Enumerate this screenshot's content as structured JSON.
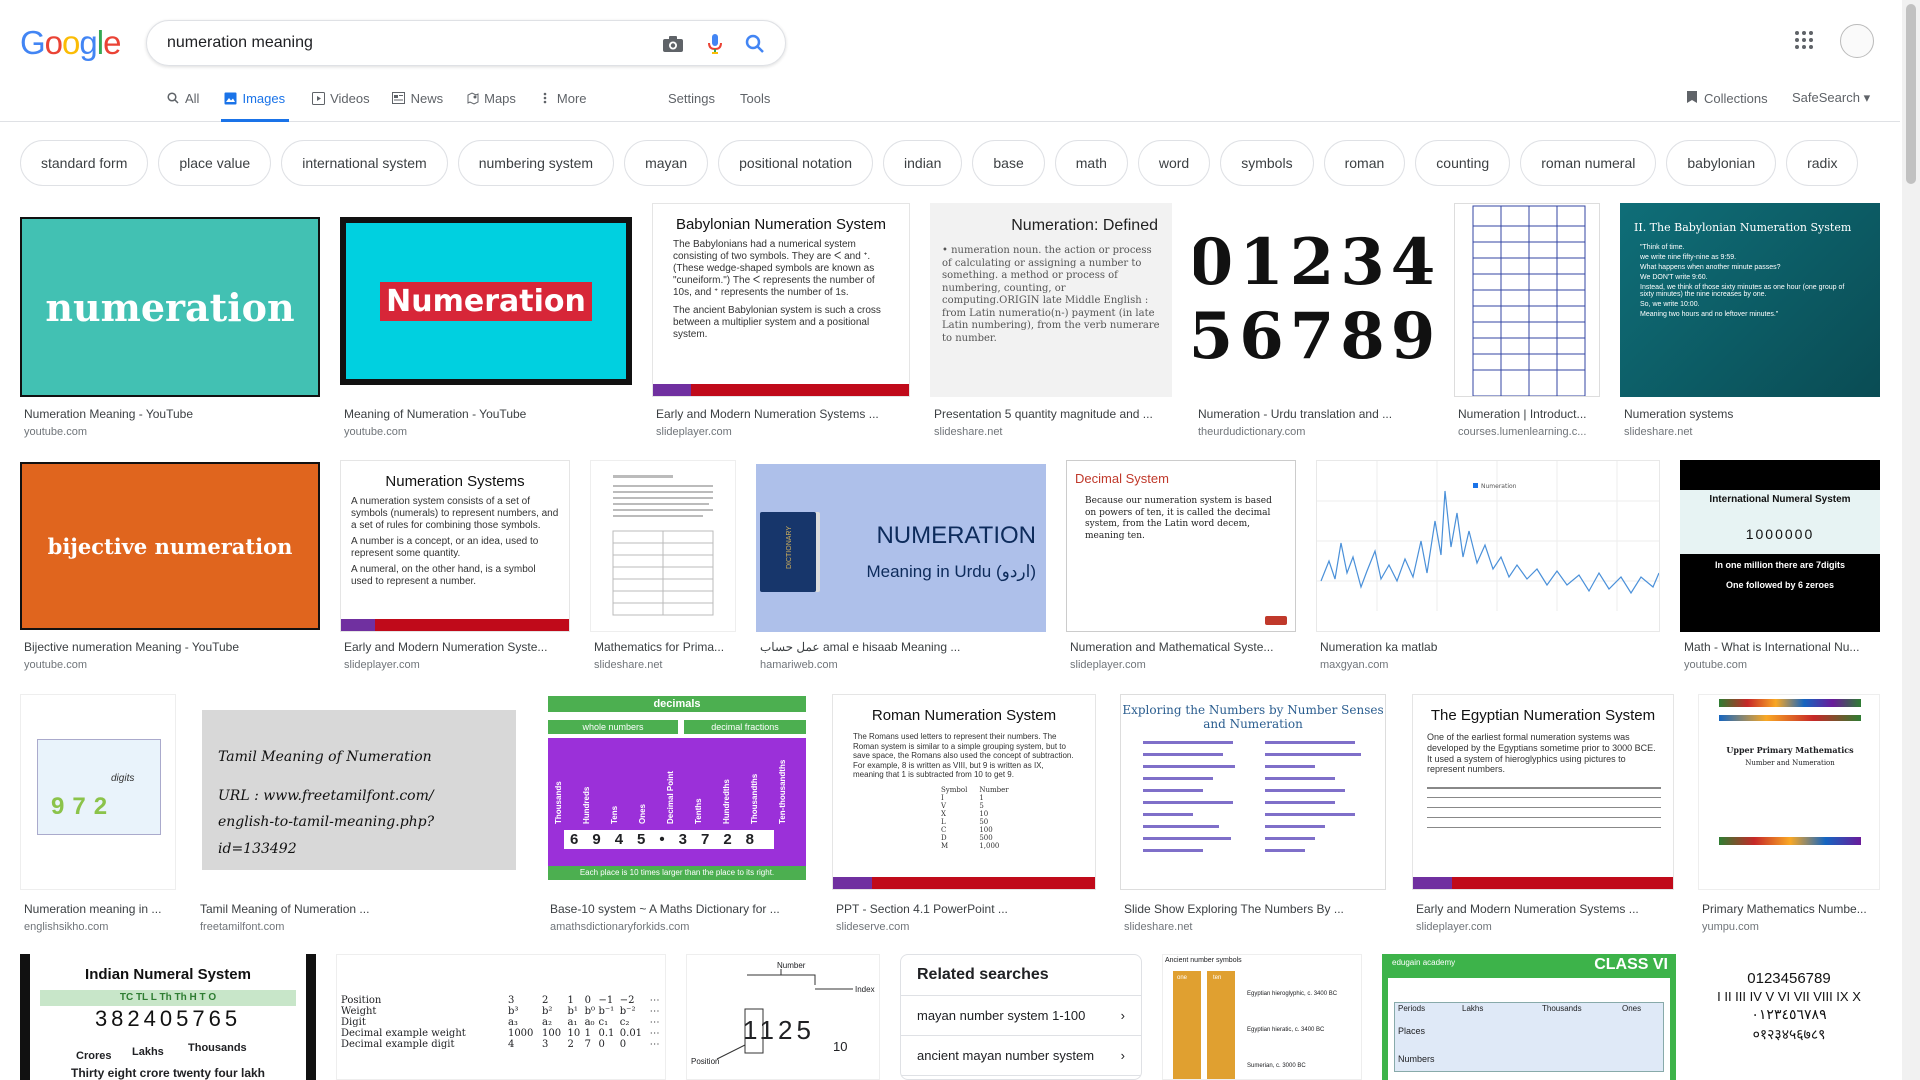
{
  "header": {
    "logo": [
      "G",
      "o",
      "o",
      "g",
      "l",
      "e"
    ],
    "logo_colors": [
      "#4285F4",
      "#EA4335",
      "#FBBC05",
      "#4285F4",
      "#34A853",
      "#EA4335"
    ],
    "query": "numeration meaning",
    "icons": [
      "camera-icon",
      "mic-icon",
      "search-icon",
      "apps-icon"
    ],
    "tabs": [
      {
        "label": "All",
        "icon": "search-icon"
      },
      {
        "label": "Images",
        "icon": "image-icon"
      },
      {
        "label": "Videos",
        "icon": "play-icon"
      },
      {
        "label": "News",
        "icon": "news-icon"
      },
      {
        "label": "Maps",
        "icon": "map-pin-icon"
      },
      {
        "label": "More",
        "icon": "kebab-icon"
      }
    ],
    "settings_label": "Settings",
    "tools_label": "Tools",
    "collections_label": "Collections",
    "safesearch_label": "SafeSearch"
  },
  "chips": [
    "standard form",
    "place value",
    "international system",
    "numbering system",
    "mayan",
    "positional notation",
    "indian",
    "base",
    "math",
    "word",
    "symbols",
    "roman",
    "counting",
    "roman numeral",
    "babylonian",
    "radix"
  ],
  "results": [
    {
      "caption": "Numeration Meaning - YouTube",
      "source": "youtube.com",
      "text": "numeration"
    },
    {
      "caption": "Meaning of Numeration - YouTube",
      "source": "youtube.com",
      "text": "Numeration"
    },
    {
      "caption": "Early and Modern Numeration Systems ...",
      "source": "slideplayer.com",
      "title": "Babylonian Numeration System",
      "p1": "The Babylonians had a numerical system consisting of two symbols. They are ᐸ and ᐩ. (These wedge-shaped symbols are known as \"cuneiform.\") The ᐸ represents the number of 10s, and ᐩ represents the number of 1s.",
      "p2": "The ancient Babylonian system is such a cross between a multiplier system and a positional system."
    },
    {
      "caption": "Presentation 5 quantity magnitude and ...",
      "source": "slideshare.net",
      "title": "Numeration: Defined",
      "p1": "• numeration noun. the action or process of calculating or assigning a number to something. a method or process of numbering, counting, or computing.ORIGIN late Middle English : from Latin numeratio(n-) payment (in late Latin numbering), from the verb numerare to number."
    },
    {
      "caption": "Numeration - Urdu translation and ...",
      "source": "theurdudictionary.com",
      "line1": "01234",
      "line2": "56789"
    },
    {
      "caption": "Numeration | Introduct...",
      "source": "courses.lumenlearning.c..."
    },
    {
      "caption": "Numeration systems",
      "source": "slideshare.net",
      "title": "II.    The Babylonian Numeration System",
      "lines": [
        "\"Think of time.",
        "we write nine fifty-nine as 9:59.",
        "What happens when another minute passes?",
        "We DON'T write 9:60.",
        "Instead, we think of those sixty minutes as one hour (one group of sixty minutes) the nine increases by one.",
        "So, we write 10:00.",
        "Meaning two hours and no leftover minutes.\""
      ]
    },
    {
      "caption": "Bijective numeration Meaning - YouTube",
      "source": "youtube.com",
      "text": "bijective numeration"
    },
    {
      "caption": "Early and Modern Numeration Syste...",
      "source": "slideplayer.com",
      "title": "Numeration Systems",
      "p1": "A numeration system consists of a set of symbols (numerals) to represent numbers, and a set of rules for combining those symbols.",
      "p2": "A number is a concept, or an idea, used to represent some quantity.",
      "p3": "A numeral, on the other hand, is a symbol used to represent a number."
    },
    {
      "caption": "Mathematics for Prima...",
      "source": "slideshare.net"
    },
    {
      "caption": "عمل حساب amal e hisaab Meaning ...",
      "source": "hamariweb.com",
      "title": "NUMERATION",
      "sub": "Meaning in Urdu (اردو)",
      "book": "DICTIONARY"
    },
    {
      "caption": "Numeration and Mathematical Syste...",
      "source": "slideplayer.com",
      "title": "Decimal System",
      "p1": "Because our numeration system is based on powers of ten, it is called the decimal system, from the Latin word decem, meaning ten."
    },
    {
      "caption": "Numeration ka matlab",
      "source": "maxgyan.com",
      "legend": "Numeration"
    },
    {
      "caption": "Math - What is International Nu...",
      "source": "youtube.com",
      "title": "International Numeral System",
      "digits": "1000000",
      "l1": "In one million there are 7digits",
      "l2": "One followed by 6 zeroes"
    },
    {
      "caption": "Numeration meaning in ...",
      "source": "englishsikho.com",
      "digits": "972",
      "label": "digits"
    },
    {
      "caption": "Tamil Meaning of Numeration ...",
      "source": "freetamilfont.com",
      "l1": "Tamil Meaning of Numeration",
      "l2": "URL : www.freetamilfont.com/",
      "l3": "english-to-tamil-meaning.php?id=133492"
    },
    {
      "caption": "Base-10 system ~ A Maths Dictionary for ...",
      "source": "amathsdictionaryforkids.com",
      "title": "decimals",
      "left": "whole numbers",
      "right": "decimal fractions",
      "cols": [
        "Thousands",
        "Hundreds",
        "Tens",
        "Ones",
        "Decimal Point",
        "Tenths",
        "Hundredths",
        "Thousandths",
        "Ten-thousandths"
      ],
      "digits": [
        "6",
        "9",
        "4",
        "5",
        "•",
        "3",
        "7",
        "2",
        "8"
      ],
      "foot": "Each place is 10 times larger than the place to its right."
    },
    {
      "caption": "PPT - Section 4.1 PowerPoint ...",
      "source": "slideserve.com",
      "title": "Roman Numeration System",
      "p1": "The Romans used letters to represent their numbers. The Roman system is similar to a simple grouping system, but to save space, the Romans also used the concept of subtraction. For example, 8 is written as VIII, but 9 is written as IX, meaning that 1 is subtracted from 10 to get 9.",
      "rows": [
        [
          "Symbol",
          "Number"
        ],
        [
          "I",
          "1"
        ],
        [
          "V",
          "5"
        ],
        [
          "X",
          "10"
        ],
        [
          "L",
          "50"
        ],
        [
          "C",
          "100"
        ],
        [
          "D",
          "500"
        ],
        [
          "M",
          "1,000"
        ]
      ]
    },
    {
      "caption": "Slide Show Exploring The Numbers By ...",
      "source": "slideshare.net",
      "title": "Exploring the Numbers by Number Senses and Numeration"
    },
    {
      "caption": "Early and Modern Numeration Systems ...",
      "source": "slideplayer.com",
      "title": "The Egyptian Numeration System",
      "p1": "One of the earliest formal numeration systems was developed by the Egyptians sometime prior to 3000 BCE. It used a system of hieroglyphics using pictures to represent numbers."
    },
    {
      "caption": "Primary Mathematics Numbe...",
      "source": "yumpu.com",
      "title": "Upper Primary Mathematics",
      "sub": "Number and Numeration"
    },
    {
      "title": "Indian Numeral System",
      "letters": "TC TL L Th Th H T O",
      "digits": "382405765",
      "l1": "Crores",
      "l2": "Lakhs",
      "l3": "Thousands",
      "l4": "Thirty eight crore twenty four lakh"
    },
    {
      "rows": [
        [
          "Position",
          "3",
          "2",
          "1",
          "0",
          "−1",
          "−2",
          "⋯"
        ],
        [
          "Weight",
          "b³",
          "b²",
          "b¹",
          "b⁰",
          "b⁻¹",
          "b⁻²",
          "⋯"
        ],
        [
          "Digit",
          "a₃",
          "a₂",
          "a₁",
          "a₀",
          "c₁",
          "c₂",
          "⋯"
        ],
        [
          "Decimal example weight",
          "1000",
          "100",
          "10",
          "1",
          "0.1",
          "0.01",
          "⋯"
        ],
        [
          "Decimal example digit",
          "4",
          "3",
          "2",
          "7",
          "0",
          "0",
          "⋯"
        ]
      ]
    },
    {
      "l1": "Number",
      "l2": "Index",
      "digits": "1125",
      "exp": "10",
      "pos": "Position"
    },
    {
      "title": "Ancient number symbols",
      "c1": "one",
      "c2": "ten",
      "r1": "Egyptian hieroglyphic, c. 3400 BC",
      "r2": "Egyptian hieratic, c. 3400 BC",
      "r3": "Sumerian, c. 3000 BC"
    },
    {
      "badge": "CLASS VI",
      "logo": "edugain academy",
      "h1": "Periods",
      "h2": "Lakhs",
      "h3": "Thousands",
      "h4": "Ones",
      "places": "Places",
      "numbers": "Numbers"
    },
    {
      "l1": "0123456789",
      "l2": "I II III IV V VI VII VIII IX X",
      "l3": "٠١٢٣٤٥٦٧٨٩",
      "l4": "०१२३४५६७८९"
    }
  ],
  "related": {
    "title": "Related searches",
    "items": [
      "mayan number system 1-100",
      "ancient mayan number system"
    ]
  },
  "colors": {
    "accent": "#1a73e8",
    "text_secondary": "#5f6368"
  }
}
